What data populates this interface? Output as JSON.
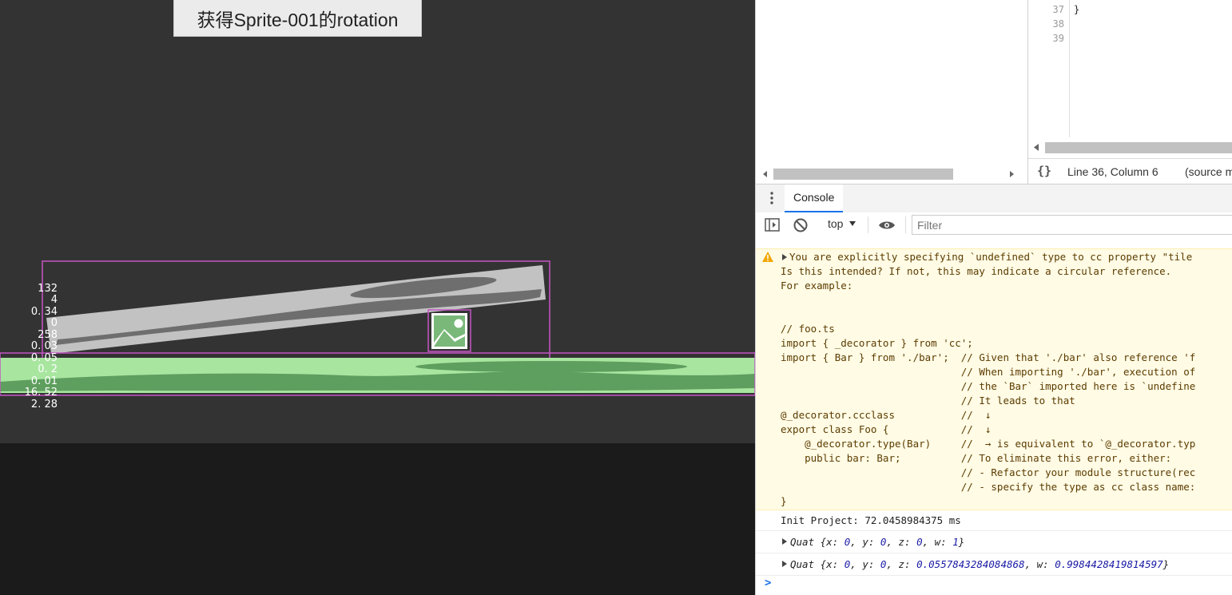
{
  "game": {
    "button_label": "获得Sprite-001的rotation",
    "stats": [
      "132",
      "4",
      "0. 34",
      "0",
      "258",
      "0. 03",
      "0. 05",
      "0. 2",
      "0. 01",
      "16. 52",
      "2. 28"
    ]
  },
  "editor": {
    "line_numbers": [
      "37",
      "38",
      "39"
    ],
    "code_lines": [
      "}",
      "",
      ""
    ],
    "format_icon": "{}",
    "cursor_position": "Line 36, Column 6",
    "source_map": "(source m"
  },
  "drawer": {
    "tab_label": "Console"
  },
  "console_toolbar": {
    "context": "top",
    "filter_placeholder": "Filter"
  },
  "console": {
    "warning_lines": [
      "You are explicitly specifying `undefined` type to cc property \"tile",
      "Is this intended? If not, this may indicate a circular reference.",
      "For example:",
      "",
      "",
      "// foo.ts",
      "import { _decorator } from 'cc';",
      "import { Bar } from './bar';  // Given that './bar' also reference 'f",
      "                              // When importing './bar', execution of",
      "                              // the `Bar` imported here is `undefine",
      "                              // It leads to that",
      "@_decorator.ccclass           //  ↓",
      "export class Foo {            //  ↓",
      "    @_decorator.type(Bar)     //  → is equivalent to `@_decorator.typ",
      "    public bar: Bar;          // To eliminate this error, either:",
      "                              // - Refactor your module structure(rec",
      "                              // - specify the type as cc class name:",
      "}"
    ],
    "init_message": "Init Project: 72.0458984375 ms",
    "quat1": {
      "label": "Quat",
      "x": "0",
      "y": "0",
      "z": "0",
      "w": "1"
    },
    "quat2": {
      "label": "Quat",
      "x": "0",
      "y": "0",
      "z": "0.0557843284084868",
      "w": "0.9984428419814597"
    },
    "prompt": ">"
  },
  "colors": {
    "game_bg": "#333333",
    "ground_light": "#a8e6a0",
    "ground_dark": "#5e9e5e",
    "plank_light": "#c2c2c2",
    "plank_dark": "#6a6a6a",
    "selection": "#c455c4",
    "warning_bg": "#fffbe5"
  }
}
